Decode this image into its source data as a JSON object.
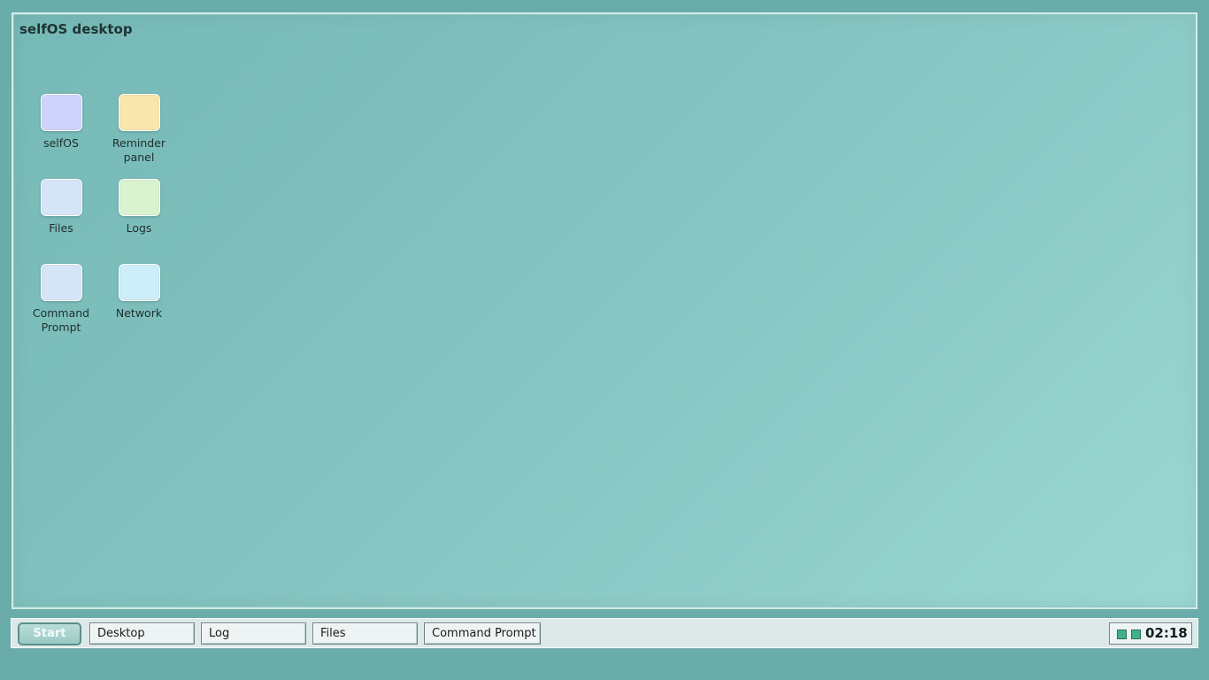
{
  "desktop": {
    "title": "selfOS desktop",
    "icons": [
      {
        "label_lines": [
          "selfOS"
        ],
        "icon": "selfos-app-icon",
        "color": "#cfd3fb"
      },
      {
        "label_lines": [
          "Reminder",
          "panel"
        ],
        "icon": "reminder-panel-icon",
        "color": "#f9e6ad"
      },
      {
        "label_lines": [
          "Files"
        ],
        "icon": "files-icon",
        "color": "#d6e4f8"
      },
      {
        "label_lines": [
          "Logs"
        ],
        "icon": "logs-icon",
        "color": "#d9f2cf"
      },
      {
        "label_lines": [
          "Command",
          "Prompt"
        ],
        "icon": "command-prompt-icon",
        "color": "#d6e4f8"
      },
      {
        "label_lines": [
          "Network"
        ],
        "icon": "network-icon",
        "color": "#cdeef8"
      }
    ]
  },
  "taskbar": {
    "start_label": "Start",
    "tasks": [
      "Desktop",
      "Log",
      "Files",
      "Command Prompt"
    ],
    "tray": {
      "indicators": [
        "status-indicator-icon",
        "status-indicator-icon"
      ],
      "indicator_color": "#3fb28b",
      "clock": "02:18"
    }
  },
  "colors": {
    "background": "#69aca9",
    "desktop_gradient_start": "#75b9b6",
    "desktop_gradient_end": "#9ad7d3",
    "taskbar": "#dde9e8"
  }
}
